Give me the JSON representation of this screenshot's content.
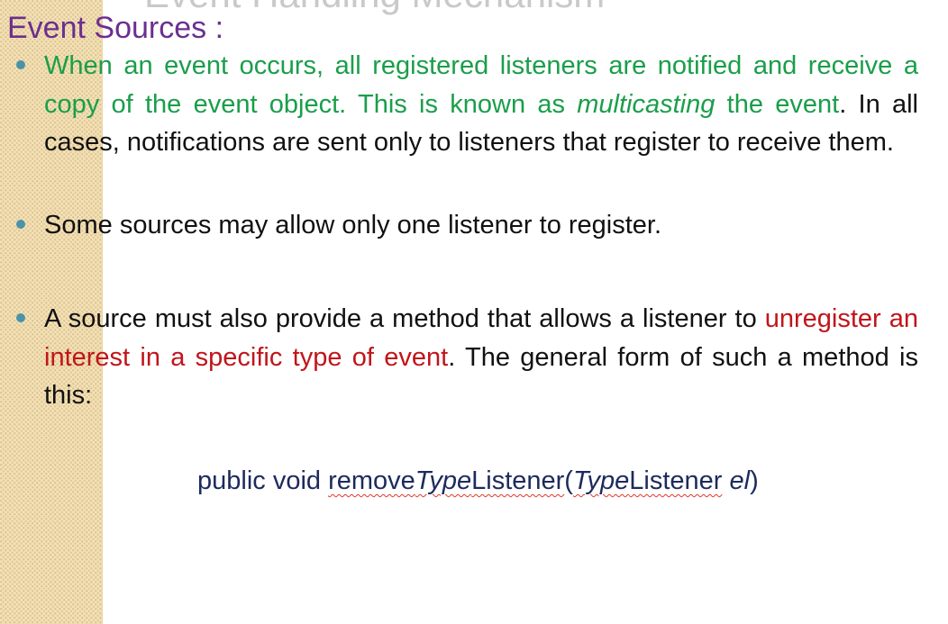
{
  "slide": {
    "title_partial": "Event Handling Mechanism",
    "heading": "Event Sources :",
    "bullet1": {
      "green_1": "When an event occurs, all registered listeners are notified and receive a copy of the event object. This is known as ",
      "green_em": "multicasting",
      "green_2": " the event",
      "rest": ". In all cases, notifications are sent only to listeners that register to receive them."
    },
    "bullet2": "Some sources may allow only one listener to register.",
    "bullet3": {
      "text_1": "A source must also provide a method that allows a listener to ",
      "red": "unregister an interest in a specific type of event",
      "text_2": ". The general form of such a method is this:"
    },
    "code": {
      "prefix": "public void ",
      "remove": "remove",
      "type1": "Type",
      "listener1": "Listener",
      "open_paren": "(",
      "type2": "Type",
      "listener2": "Listener",
      "space": " ",
      "param": "el",
      "close_paren": ")"
    },
    "colors": {
      "heading": "#6b2f8f",
      "highlight_green": "#1a9e4a",
      "highlight_red": "#c0151b",
      "code_text": "#1d2a5e",
      "bullet_dot": "#4a93a8",
      "side_strip": "#f3e2b8"
    }
  }
}
